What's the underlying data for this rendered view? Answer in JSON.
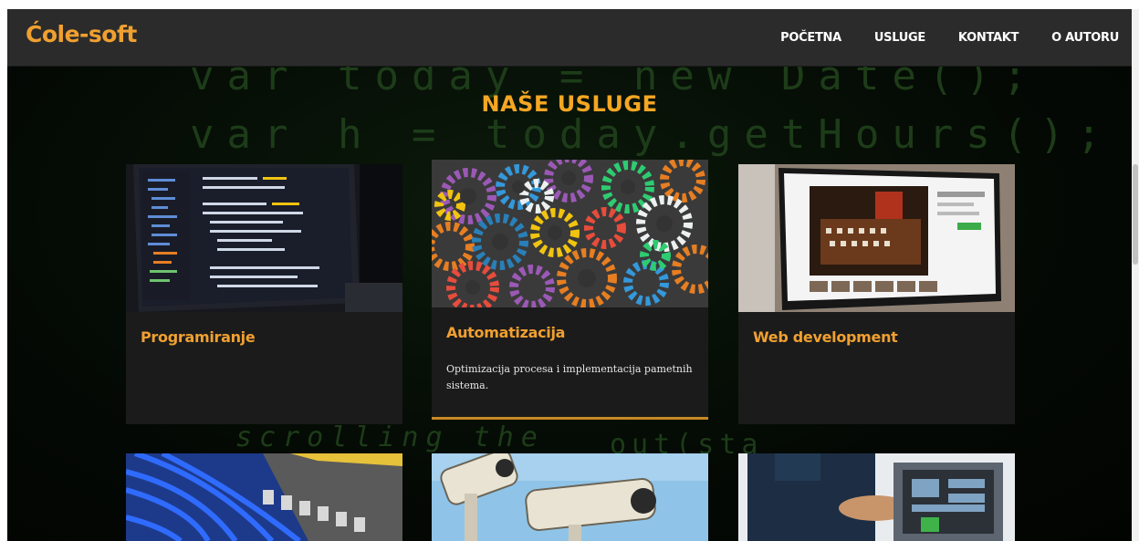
{
  "brand": {
    "logo_text": "Ćole-soft",
    "color": "#f0a030"
  },
  "nav": {
    "items": [
      {
        "label": "POČETNA"
      },
      {
        "label": "USLUGE"
      },
      {
        "label": "KONTAKT"
      },
      {
        "label": "O AUTORU"
      }
    ]
  },
  "section": {
    "title": "NAŠE USLUGE"
  },
  "background_code": {
    "line1": "var today = new Date();",
    "line2": "var h = today.getHours();",
    "line3": "scrolling the",
    "line4": "out(sta"
  },
  "services": {
    "cards": [
      {
        "title": "Programiranje",
        "description": "",
        "image": "laptop-code-image"
      },
      {
        "title": "Automatizacija",
        "description": "Optimizacija procesa i implementacija pametnih sistema.",
        "image": "colorful-gears-image"
      },
      {
        "title": "Web development",
        "description": "",
        "image": "web-monitor-image"
      }
    ],
    "row2_images": [
      "network-cables-image",
      "security-cameras-image",
      "computer-repair-image"
    ]
  },
  "colors": {
    "accent": "#f0a030",
    "navbar": "#2b2b2b",
    "card": "#1b1b1b",
    "background": "#030703"
  }
}
